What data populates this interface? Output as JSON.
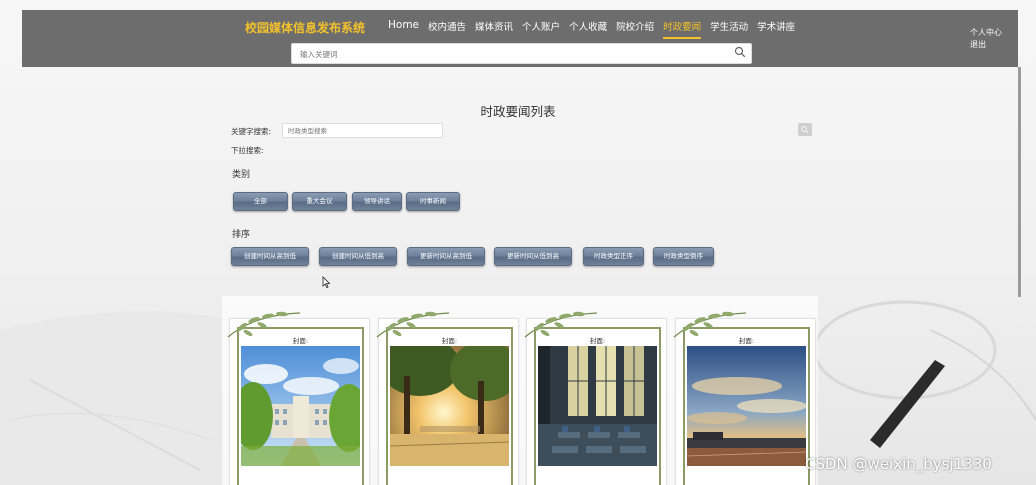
{
  "header": {
    "site_title": "校园媒体信息发布系统",
    "nav": [
      {
        "label": "Home"
      },
      {
        "label": "校内通告"
      },
      {
        "label": "媒体资讯"
      },
      {
        "label": "个人账户"
      },
      {
        "label": "个人收藏"
      },
      {
        "label": "院校介绍"
      },
      {
        "label": "时政要闻",
        "active": true
      },
      {
        "label": "学生活动"
      },
      {
        "label": "学术讲座"
      }
    ],
    "user_center": "个人中心",
    "logout": "退出",
    "search_placeholder": "输入关键词"
  },
  "main": {
    "title": "时政要闻列表",
    "keyword_label": "关键字搜索:",
    "keyword_placeholder": "时政类型搜索",
    "dropdown_label": "下拉搜索:",
    "category_heading": "类别",
    "categories": [
      "全部",
      "重大会议",
      "领导讲话",
      "时事新闻"
    ],
    "sort_heading": "排序",
    "sorts": [
      "创建时间从高到低",
      "创建时间从低到高",
      "更新时间从高到低",
      "更新时间从低到高",
      "时政类型正序",
      "时政类型倒序"
    ]
  },
  "cards": [
    {
      "label": "封面:",
      "image": "campus-building"
    },
    {
      "label": "封面:",
      "image": "tree-sunset"
    },
    {
      "label": "封面:",
      "image": "classroom"
    },
    {
      "label": "封面:",
      "image": "sky-track"
    }
  ],
  "watermark": "CSDN @weixin_bysj1330",
  "colors": {
    "header_bg": "#6d6d6d",
    "accent": "#f3c12b",
    "button": "#6f829c",
    "card_frame": "#8c9a66"
  }
}
